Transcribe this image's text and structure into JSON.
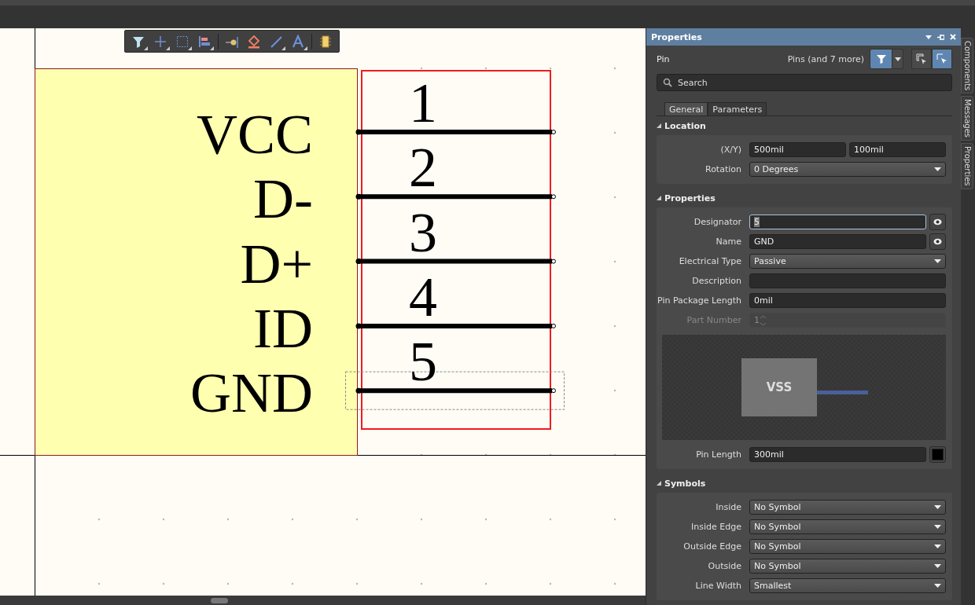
{
  "schematic": {
    "pins": [
      {
        "designator": "1",
        "name": "VCC",
        "selected": false
      },
      {
        "designator": "2",
        "name": "D-",
        "selected": false
      },
      {
        "designator": "3",
        "name": "D+",
        "selected": false
      },
      {
        "designator": "4",
        "name": "ID",
        "selected": false
      },
      {
        "designator": "5",
        "name": "GND",
        "selected": true
      }
    ]
  },
  "properties_panel": {
    "title": "Properties",
    "object_type": "Pin",
    "selection_filter": "Pins (and 7 more)",
    "search": {
      "placeholder": "Search"
    },
    "tabs": [
      {
        "label": "General",
        "selected": true
      },
      {
        "label": "Parameters",
        "selected": false
      }
    ],
    "sections": [
      {
        "title": "Location",
        "expanded": true,
        "rows": [
          {
            "kind": "pair",
            "label": "(X/Y)",
            "values": [
              "500mil",
              "100mil"
            ]
          },
          {
            "kind": "dropdown",
            "label": "Rotation",
            "value": "0 Degrees"
          }
        ]
      },
      {
        "title": "Properties",
        "expanded": true,
        "rows": [
          {
            "kind": "text",
            "label": "Designator",
            "value": "5",
            "focused": true,
            "eye": true
          },
          {
            "kind": "text",
            "label": "Name",
            "value": "GND",
            "eye": true
          },
          {
            "kind": "dropdown",
            "label": "Electrical Type",
            "value": "Passive"
          },
          {
            "kind": "text",
            "label": "Description"
          },
          {
            "kind": "text",
            "label": "Pin Package Length",
            "value": "0mil"
          },
          {
            "kind": "spinner",
            "label": "Part Number",
            "value": "1",
            "disabled": true
          },
          {
            "kind": "preview",
            "pin_name": "VSS"
          },
          {
            "kind": "text",
            "label": "Pin Length",
            "value": "300mil",
            "color": "#000000"
          }
        ]
      },
      {
        "title": "Symbols",
        "expanded": true,
        "rows": [
          {
            "kind": "dropdown",
            "label": "Inside",
            "value": "No Symbol"
          },
          {
            "kind": "dropdown",
            "label": "Inside Edge",
            "value": "No Symbol"
          },
          {
            "kind": "dropdown",
            "label": "Outside Edge",
            "value": "No Symbol"
          },
          {
            "kind": "dropdown",
            "label": "Outside",
            "value": "No Symbol"
          },
          {
            "kind": "dropdown",
            "label": "Line Width",
            "value": "Smallest"
          }
        ]
      }
    ]
  },
  "side_tabs": [
    "Components",
    "Messages",
    "Properties"
  ]
}
